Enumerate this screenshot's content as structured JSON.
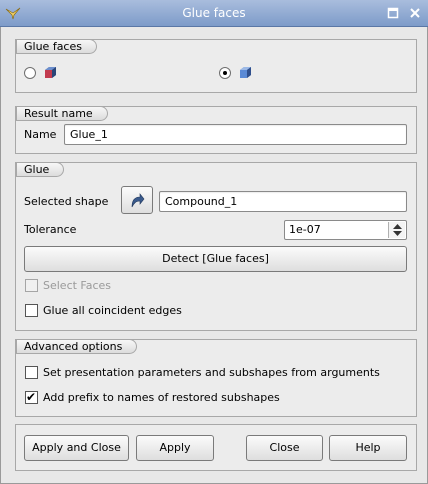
{
  "window": {
    "title": "Glue faces"
  },
  "groups": {
    "glue_faces": {
      "label": "Glue faces"
    },
    "result_name": {
      "label": "Result name",
      "name_label": "Name",
      "name_value": "Glue_1"
    },
    "glue": {
      "label": "Glue",
      "selected_shape_label": "Selected shape",
      "selected_shape_value": "Compound_1",
      "tolerance_label": "Tolerance",
      "tolerance_value": "1e-07",
      "detect_label": "Detect [Glue faces]",
      "select_faces_label": "Select Faces",
      "glue_all_edges_label": "Glue all coincident edges"
    },
    "advanced": {
      "label": "Advanced options",
      "set_presentation_label": "Set presentation parameters and subshapes from arguments",
      "add_prefix_label": "Add prefix to names of restored subshapes"
    }
  },
  "buttons": {
    "apply_close": "Apply and Close",
    "apply": "Apply",
    "close": "Close",
    "help": "Help"
  },
  "colors": {
    "titlebar": "#8aa5d2",
    "background": "#e8e8e8",
    "cube_red": "#b4374a",
    "cube_blue": "#3b5fa0"
  }
}
